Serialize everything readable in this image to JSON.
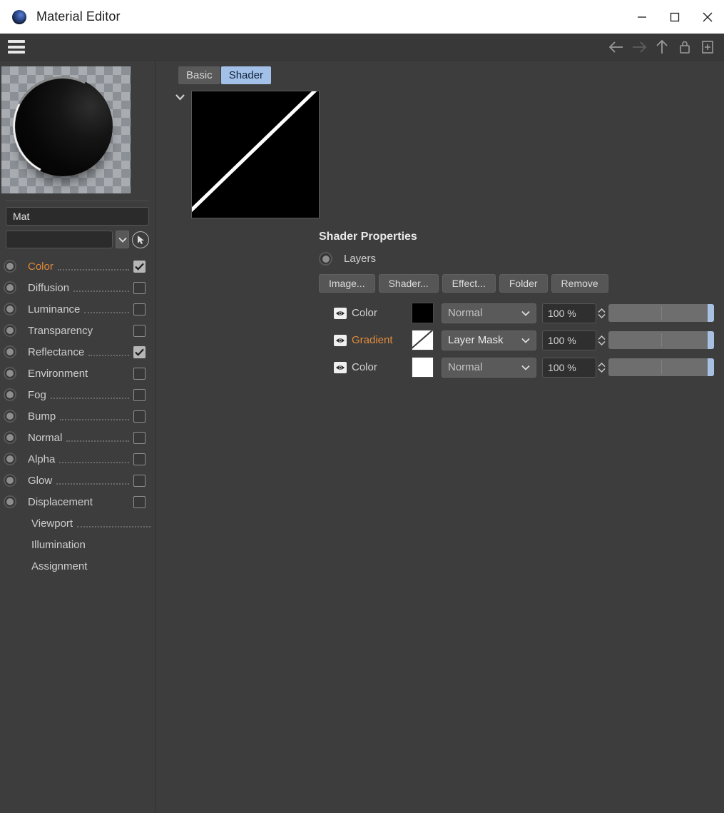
{
  "window": {
    "title": "Material Editor",
    "app_icon": "material-sphere-icon",
    "minimize_label": "Minimize",
    "maximize_label": "Maximize",
    "close_label": "Close"
  },
  "toolbar": {
    "menu_label": "Menu",
    "back_label": "Back",
    "forward_label": "Forward",
    "up_label": "Up",
    "lock_label": "Lock",
    "add_label": "Add"
  },
  "sidebar": {
    "preview_alt": "Material preview sphere on checkerboard",
    "name_value": "Mat",
    "selector_value": "",
    "picker_label": "Pick object",
    "channels": [
      {
        "label": "Color",
        "active": true,
        "checked": true,
        "dots": true,
        "control": true
      },
      {
        "label": "Diffusion",
        "active": false,
        "checked": false,
        "dots": true,
        "control": true
      },
      {
        "label": "Luminance",
        "active": false,
        "checked": false,
        "dots": true,
        "control": true
      },
      {
        "label": "Transparency",
        "active": false,
        "checked": false,
        "dots": false,
        "control": true
      },
      {
        "label": "Reflectance",
        "active": false,
        "checked": true,
        "dots": true,
        "control": true
      },
      {
        "label": "Environment",
        "active": false,
        "checked": false,
        "dots": false,
        "control": true
      },
      {
        "label": "Fog",
        "active": false,
        "checked": false,
        "dots": true,
        "control": true
      },
      {
        "label": "Bump",
        "active": false,
        "checked": false,
        "dots": true,
        "control": true
      },
      {
        "label": "Normal",
        "active": false,
        "checked": false,
        "dots": true,
        "control": true
      },
      {
        "label": "Alpha",
        "active": false,
        "checked": false,
        "dots": true,
        "control": true
      },
      {
        "label": "Glow",
        "active": false,
        "checked": false,
        "dots": true,
        "control": true
      },
      {
        "label": "Displacement",
        "active": false,
        "checked": false,
        "dots": false,
        "control": true
      },
      {
        "label": "Viewport",
        "active": false,
        "checked": false,
        "dots": true,
        "control": false
      },
      {
        "label": "Illumination",
        "active": false,
        "checked": false,
        "dots": false,
        "control": false
      },
      {
        "label": "Assignment",
        "active": false,
        "checked": false,
        "dots": false,
        "control": false
      }
    ]
  },
  "main": {
    "tabs": [
      {
        "label": "Basic",
        "active": false
      },
      {
        "label": "Shader",
        "active": true
      }
    ],
    "shader_preview_alt": "Black thumbnail with white diagonal gradient line",
    "properties_title": "Shader Properties",
    "layers_label": "Layers",
    "buttons": [
      {
        "label": "Image..."
      },
      {
        "label": "Shader..."
      },
      {
        "label": "Effect..."
      },
      {
        "label": "Folder"
      },
      {
        "label": "Remove"
      }
    ],
    "layers": [
      {
        "name": "Color",
        "active": false,
        "swatch": "#000000",
        "swatch_type": "solid",
        "mode": "Normal",
        "mode_bright": false,
        "opacity": "100 %",
        "slider_pct": 100
      },
      {
        "name": "Gradient",
        "active": true,
        "swatch": "#ffffff",
        "swatch_type": "gradient",
        "mode": "Layer Mask",
        "mode_bright": true,
        "opacity": "100 %",
        "slider_pct": 100
      },
      {
        "name": "Color",
        "active": false,
        "swatch": "#ffffff",
        "swatch_type": "solid",
        "mode": "Normal",
        "mode_bright": false,
        "opacity": "100 %",
        "slider_pct": 100
      }
    ]
  },
  "colors": {
    "background": "#3d3d3d",
    "titlebar": "#ffffff",
    "accent_orange": "#e08b3c",
    "tab_active": "#a3c1e8",
    "slider_handle": "#a8c0e2"
  }
}
